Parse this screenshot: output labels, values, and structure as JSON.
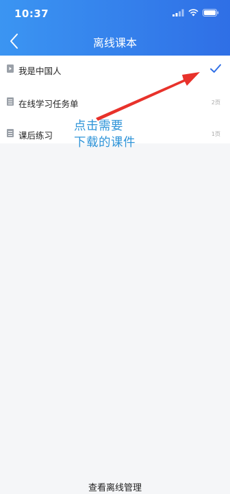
{
  "status_bar": {
    "time": "10:37"
  },
  "nav": {
    "title": "离线课本"
  },
  "lessons": [
    {
      "label": "我是中国人",
      "meta": "",
      "selected": true
    },
    {
      "label": "在线学习任务单",
      "meta": "2页",
      "selected": false
    },
    {
      "label": "课后练习",
      "meta": "1页",
      "selected": false
    }
  ],
  "annotation": {
    "line1": "点击需要",
    "line2": "下载的课件"
  },
  "footer": {
    "manage_label": "查看离线管理"
  },
  "colors": {
    "header_start": "#3b95f2",
    "header_end": "#2f6fe6",
    "check": "#2f6fe6",
    "arrow": "#e8322b",
    "annotation": "#2f94d8"
  }
}
